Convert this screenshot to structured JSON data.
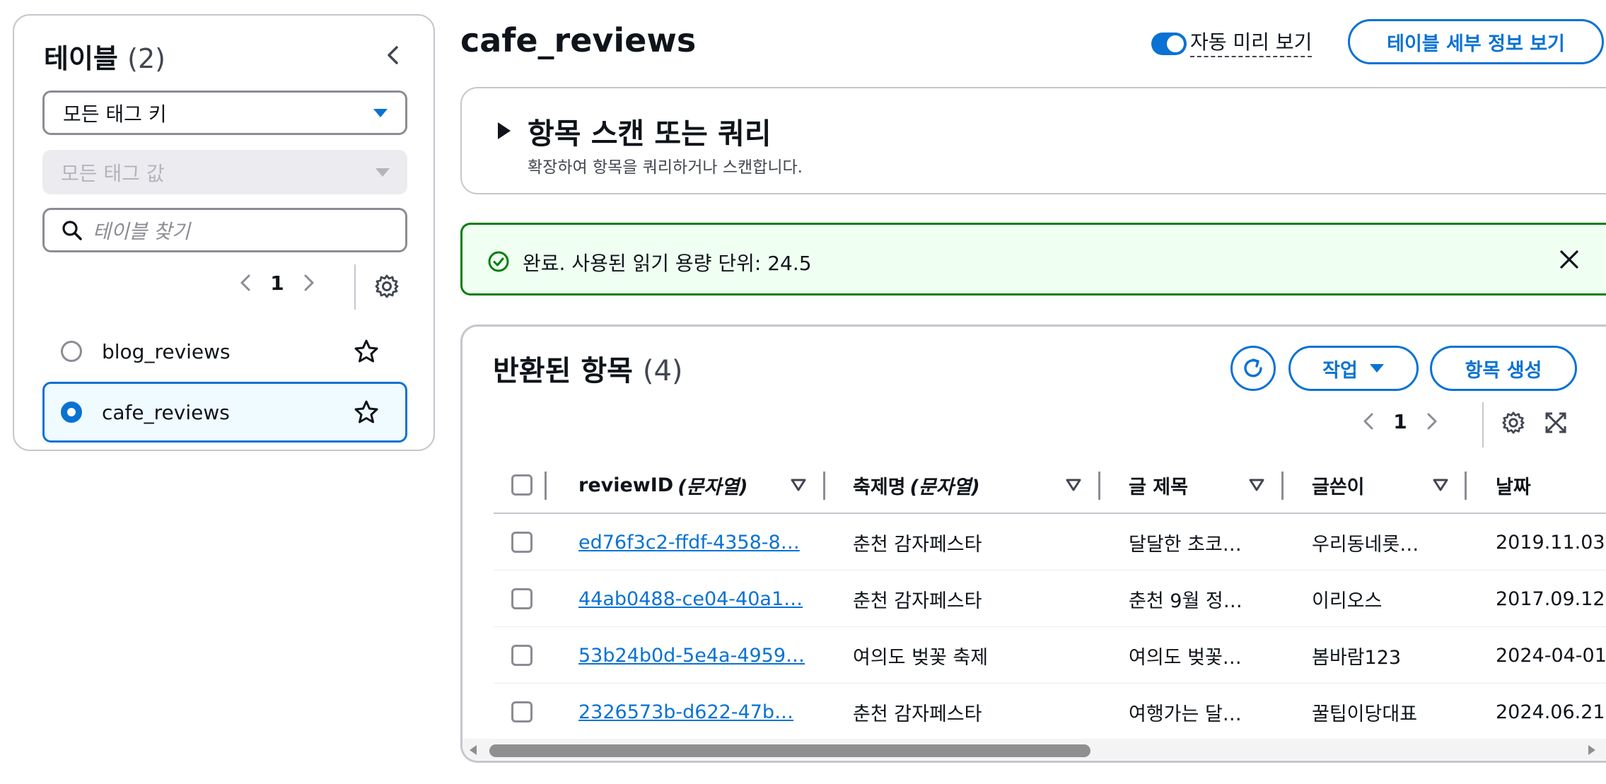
{
  "sidebar": {
    "title": "테이블",
    "count": "(2)",
    "tag_key_select": "모든 태그 키",
    "tag_value_select": "모든 태그 값",
    "search_placeholder": "테이블 찾기",
    "page": "1",
    "tables": [
      {
        "name": "blog_reviews",
        "selected": false
      },
      {
        "name": "cafe_reviews",
        "selected": true
      }
    ]
  },
  "header": {
    "title": "cafe_reviews",
    "auto_preview_label": "자동 미리 보기",
    "details_button": "테이블 세부 정보 보기"
  },
  "query_panel": {
    "title": "항목 스캔 또는 쿼리",
    "description": "확장하여 항목을 쿼리하거나 스캔합니다."
  },
  "flash": {
    "message": "완료. 사용된 읽기 용량 단위: 24.5"
  },
  "items": {
    "title": "반환된 항목",
    "count": "(4)",
    "actions_button": "작업",
    "create_button": "항목 생성",
    "page": "1",
    "columns": [
      {
        "name": "reviewID",
        "type": "(문자열)"
      },
      {
        "name": "축제명",
        "type": "(문자열)"
      },
      {
        "name": "글 제목",
        "type": ""
      },
      {
        "name": "글쓴이",
        "type": ""
      },
      {
        "name": "날짜",
        "type": ""
      }
    ],
    "rows": [
      [
        "ed76f3c2-ffdf-4358-8…",
        "춘천 감자페스타",
        "달달한 초코…",
        "우리동네롯…",
        "2019.11.03."
      ],
      [
        "44ab0488-ce04-40a1…",
        "춘천 감자페스타",
        "춘천 9월 정…",
        "이리오스",
        "2017.09.12."
      ],
      [
        "53b24b0d-5e4a-4959…",
        "여의도 벚꽃 축제",
        "여의도 벚꽃…",
        "봄바람123",
        "2024-04-01"
      ],
      [
        "2326573b-d622-47b…",
        "춘천 감자페스타",
        "여행가는 달…",
        "꿀팁이당대표",
        "2024.06.21."
      ]
    ]
  },
  "colors": {
    "accent": "#0972d3",
    "success": "#037f0c",
    "success_bg": "#effff1",
    "selected_bg": "#f0fbff",
    "border": "#c6c6cd"
  }
}
